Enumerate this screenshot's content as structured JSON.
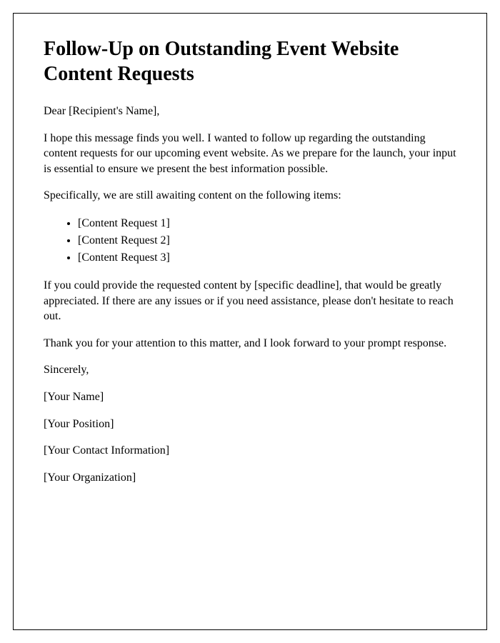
{
  "title": "Follow-Up on Outstanding Event Website Content Requests",
  "salutation": "Dear [Recipient's Name],",
  "paragraphs": {
    "intro": "I hope this message finds you well. I wanted to follow up regarding the outstanding content requests for our upcoming event website. As we prepare for the launch, your input is essential to ensure we present the best information possible.",
    "listIntro": "Specifically, we are still awaiting content on the following items:",
    "deadline": "If you could provide the requested content by [specific deadline], that would be greatly appreciated. If there are any issues or if you need assistance, please don't hesitate to reach out.",
    "thanks": "Thank you for your attention to this matter, and I look forward to your prompt response."
  },
  "contentRequests": [
    "[Content Request 1]",
    "[Content Request 2]",
    "[Content Request 3]"
  ],
  "closing": "Sincerely,",
  "signature": {
    "name": "[Your Name]",
    "position": "[Your Position]",
    "contact": "[Your Contact Information]",
    "organization": "[Your Organization]"
  }
}
